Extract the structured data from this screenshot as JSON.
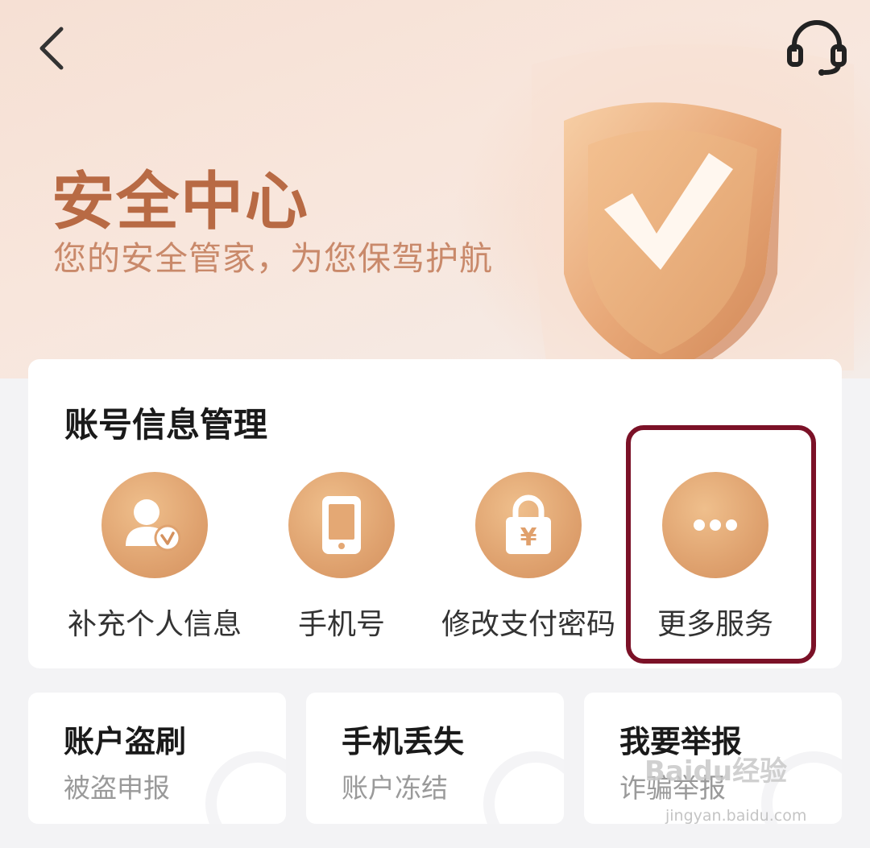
{
  "header": {
    "back_icon": "chevron-left-icon",
    "service_icon": "headset-icon",
    "title": "安全中心",
    "subtitle": "您的安全管家，为您保驾护航",
    "illustration": "shield-check-icon"
  },
  "account_section": {
    "title": "账号信息管理",
    "items": [
      {
        "label": "补充个人信息",
        "icon": "user-check-icon"
      },
      {
        "label": "手机号",
        "icon": "phone-icon"
      },
      {
        "label": "修改支付密码",
        "icon": "lock-yuan-icon"
      },
      {
        "label": "更多服务",
        "icon": "more-dots-icon",
        "highlighted": true
      }
    ]
  },
  "quick_cards": [
    {
      "title": "账户盗刷",
      "subtitle": "被盗申报"
    },
    {
      "title": "手机丢失",
      "subtitle": "账户冻结"
    },
    {
      "title": "我要举报",
      "subtitle": "诈骗举报"
    }
  ],
  "watermark": {
    "brand": "Baidu",
    "suffix": "经验",
    "url": "jingyan.baidu.com"
  },
  "colors": {
    "accent": "#b86a44",
    "icon_circle": "#dfa26f",
    "highlight_border": "#7b1127"
  }
}
